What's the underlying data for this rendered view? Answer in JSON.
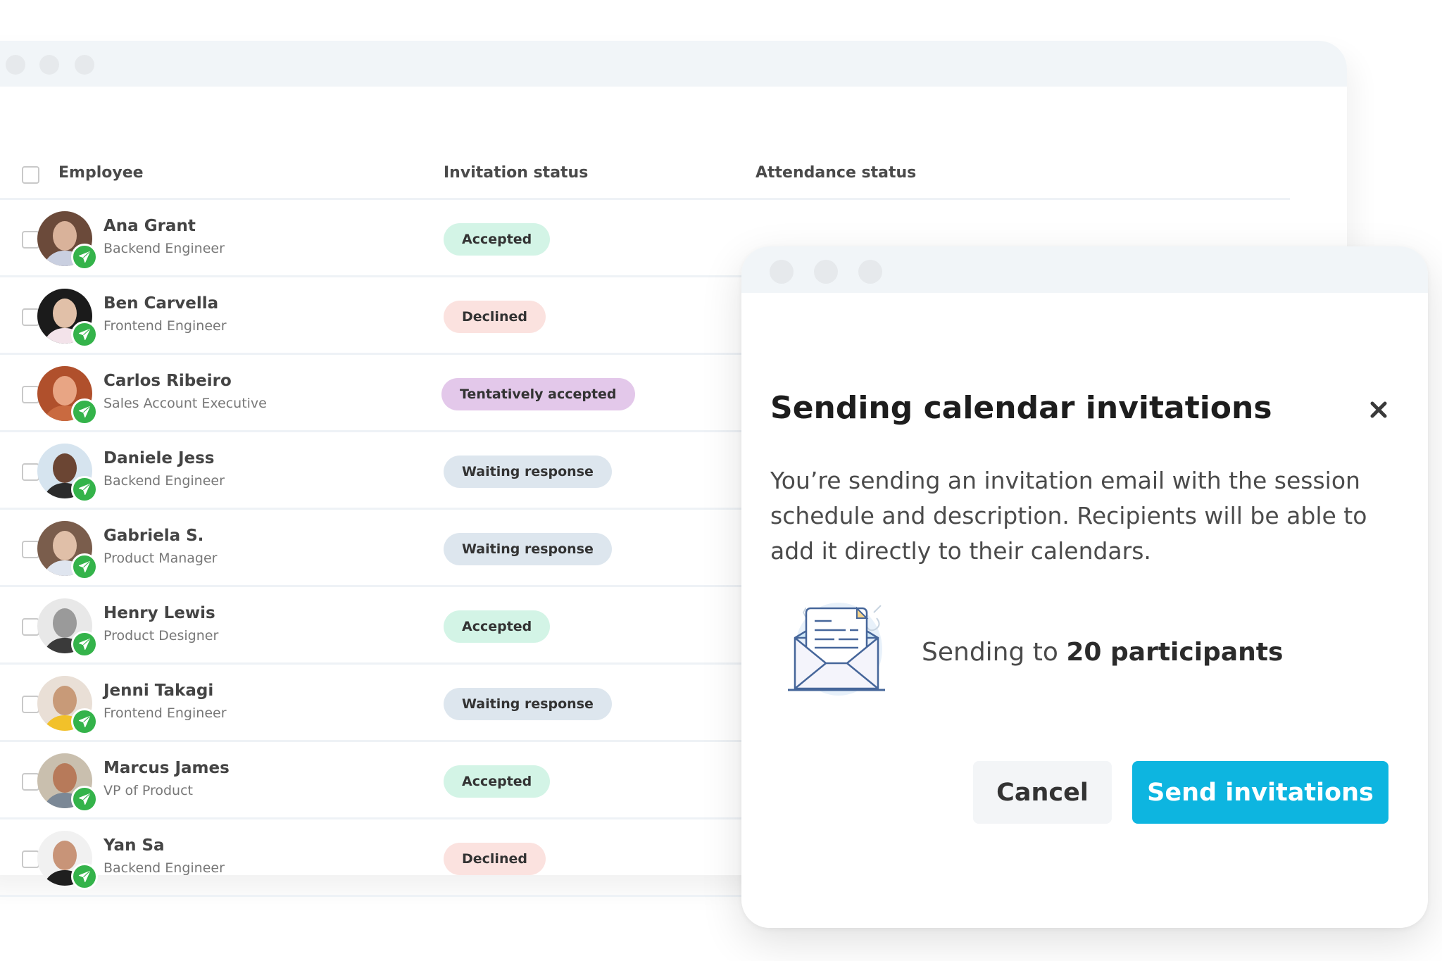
{
  "background_window": {
    "table": {
      "headers": {
        "employee": "Employee",
        "invitation_status": "Invitation status",
        "attendance_status": "Attendance status"
      },
      "rows": [
        {
          "name": "Ana Grant",
          "role": "Backend Engineer",
          "invitation_status": "Accepted",
          "status_type": "accepted",
          "attendance_status": ""
        },
        {
          "name": "Ben Carvella",
          "role": "Frontend Engineer",
          "invitation_status": "Declined",
          "status_type": "declined",
          "attendance_status": ""
        },
        {
          "name": "Carlos Ribeiro",
          "role": "Sales Account Executive",
          "invitation_status": "Tentatively accepted",
          "status_type": "tentative",
          "attendance_status": ""
        },
        {
          "name": "Daniele Jess",
          "role": "Backend Engineer",
          "invitation_status": "Waiting response",
          "status_type": "waiting",
          "attendance_status": ""
        },
        {
          "name": "Gabriela S.",
          "role": "Product Manager",
          "invitation_status": "Waiting response",
          "status_type": "waiting",
          "attendance_status": ""
        },
        {
          "name": "Henry Lewis",
          "role": "Product Designer",
          "invitation_status": "Accepted",
          "status_type": "accepted",
          "attendance_status": ""
        },
        {
          "name": "Jenni Takagi",
          "role": "Frontend Engineer",
          "invitation_status": "Waiting response",
          "status_type": "waiting",
          "attendance_status": ""
        },
        {
          "name": "Marcus James",
          "role": "VP of Product",
          "invitation_status": "Accepted",
          "status_type": "accepted",
          "attendance_status": ""
        },
        {
          "name": "Yan Sa",
          "role": "Backend Engineer",
          "invitation_status": "Declined",
          "status_type": "declined",
          "attendance_status": ""
        }
      ],
      "row_badge_icon": "paper-plane-icon"
    }
  },
  "modal": {
    "title": "Sending calendar invitations",
    "close_icon": "close-icon",
    "body": "You’re sending an invitation email with the session schedule and description. Recipients will be able to add it directly to their calendars.",
    "illustration": "envelope-icon",
    "sending_prefix": "Sending to ",
    "participants_label": "20 participants",
    "cancel_label": "Cancel",
    "send_label": "Send invitations"
  },
  "colors": {
    "accent": "#0db5e0",
    "accepted_bg": "#d3f4e6",
    "declined_bg": "#fbe2df",
    "tentative_bg": "#e3c8ea",
    "waiting_bg": "#dde6ee",
    "sent_badge": "#34b34a"
  }
}
